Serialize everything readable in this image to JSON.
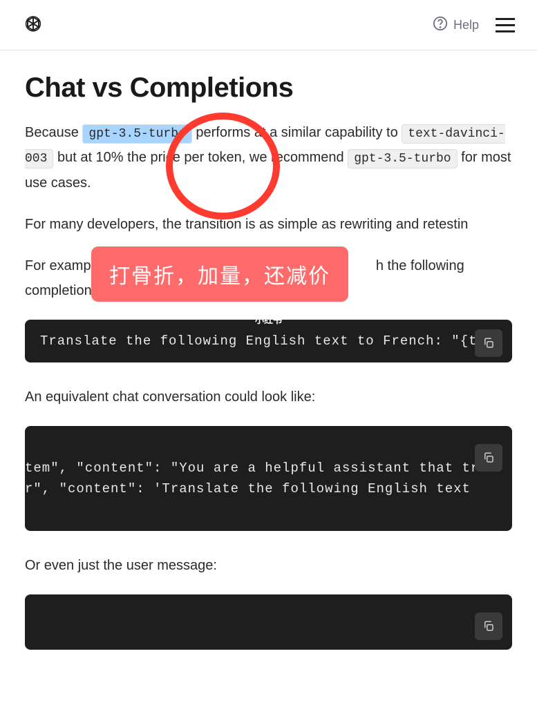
{
  "header": {
    "help_label": "Help"
  },
  "page": {
    "title": "Chat vs Completions",
    "p1": {
      "t1": "Because ",
      "code1": "gpt-3.5-turbo",
      "t2": " performs at a similar capability to ",
      "code2": "text-davinci-003",
      "t3": " but at 10% the price per token, we recommend ",
      "code3": "gpt-3.5-turbo",
      "t4": " for most use cases."
    },
    "p2": "For many developers, the transition is as simple as rewriting and retestin",
    "p3": {
      "t1": "For example,",
      "t2": "h the following completions prompt:"
    },
    "code1": "Translate the following English text to French: \"{t",
    "p4": "An equivalent chat conversation could look like:",
    "code2": {
      "line1": "tem\", \"content\": \"You are a helpful assistant that tr",
      "line2": "r\", \"content\": 'Translate the following English text "
    },
    "p5": "Or even just the user message:"
  },
  "annotation": {
    "label": "打骨折，加量，还减价",
    "watermark": "小红书"
  }
}
